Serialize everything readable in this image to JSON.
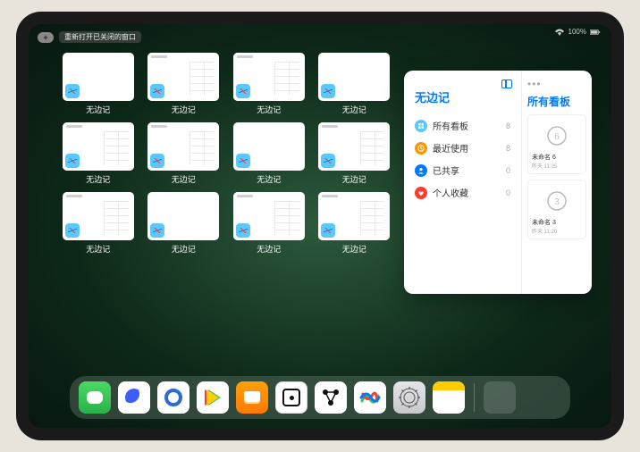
{
  "status": {
    "battery": "100%"
  },
  "header": {
    "reopen_label": "重新打开已关闭的窗口",
    "plus_label": "+"
  },
  "windows": [
    {
      "label": "无边记",
      "split": false
    },
    {
      "label": "无边记",
      "split": true
    },
    {
      "label": "无边记",
      "split": true
    },
    {
      "label": "无边记",
      "split": false
    },
    {
      "label": "无边记",
      "split": true
    },
    {
      "label": "无边记",
      "split": true
    },
    {
      "label": "无边记",
      "split": false
    },
    {
      "label": "无边记",
      "split": true
    },
    {
      "label": "无边记",
      "split": true
    },
    {
      "label": "无边记",
      "split": false
    },
    {
      "label": "无边记",
      "split": true
    },
    {
      "label": "无边记",
      "split": true
    }
  ],
  "popover": {
    "sidebar_title": "无边记",
    "right_title": "所有看板",
    "items": [
      {
        "icon": "grid",
        "color": "#5ac8fa",
        "label": "所有看板",
        "count": 8
      },
      {
        "icon": "clock",
        "color": "#ff9500",
        "label": "最近使用",
        "count": 8
      },
      {
        "icon": "person",
        "color": "#007aff",
        "label": "已共享",
        "count": 0
      },
      {
        "icon": "heart",
        "color": "#ff3b30",
        "label": "个人收藏",
        "count": 0
      }
    ],
    "boards": [
      {
        "name": "未命名 6",
        "sub": "昨天 11:25",
        "glyph": "6"
      },
      {
        "name": "未命名 3",
        "sub": "昨天 11:20",
        "glyph": "3"
      }
    ]
  },
  "dock": {
    "apps": [
      {
        "name": "wechat"
      },
      {
        "name": "quark"
      },
      {
        "name": "qqbrowser"
      },
      {
        "name": "play"
      },
      {
        "name": "books"
      },
      {
        "name": "dice"
      },
      {
        "name": "graph"
      },
      {
        "name": "freeform"
      },
      {
        "name": "settings"
      },
      {
        "name": "notes"
      }
    ],
    "suggestions": true
  }
}
